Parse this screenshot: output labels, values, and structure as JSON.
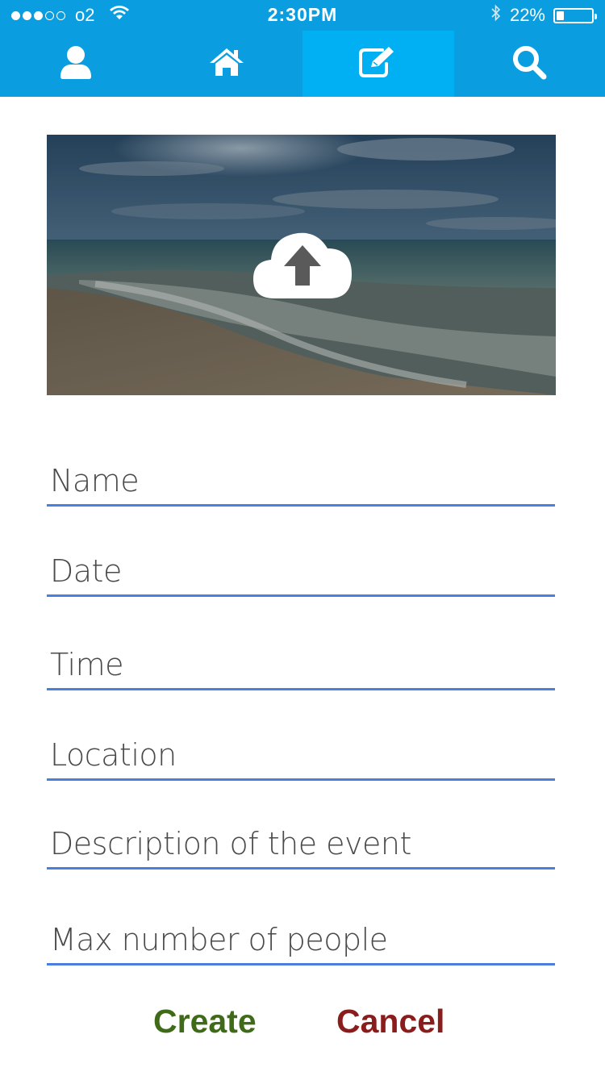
{
  "status_bar": {
    "carrier": "o2",
    "time": "2:30PM",
    "battery": "22%",
    "signal_bars_filled": 3,
    "signal_bars_total": 5,
    "battery_level": 0.22
  },
  "nav": {
    "tabs": [
      {
        "name": "profile",
        "icon": "user-icon",
        "active": false
      },
      {
        "name": "home",
        "icon": "home-icon",
        "active": false
      },
      {
        "name": "create",
        "icon": "edit-icon",
        "active": true
      },
      {
        "name": "search",
        "icon": "search-icon",
        "active": false
      }
    ]
  },
  "upload": {
    "icon": "cloud-upload-icon"
  },
  "form": {
    "name_placeholder": "Name",
    "date_placeholder": "Date",
    "time_placeholder": "Time",
    "location_placeholder": "Location",
    "description_placeholder": "Description of the event",
    "max_people_placeholder": "Max number of people"
  },
  "actions": {
    "create_label": "Create",
    "cancel_label": "Cancel"
  },
  "colors": {
    "topbar": "#0a9ee0",
    "active_tab": "#00b0f3",
    "field_underline": "#4a7fdd",
    "create": "#3f6b19",
    "cancel": "#8a1c1c"
  }
}
